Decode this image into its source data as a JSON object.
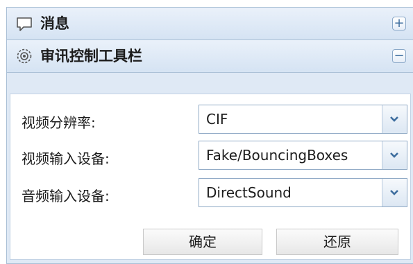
{
  "panel": {
    "sections": [
      {
        "title": "消息",
        "icon": "message-icon",
        "toggle": "+"
      },
      {
        "title": "审讯控制工具栏",
        "icon": "gear-icon",
        "toggle": "−"
      }
    ]
  },
  "form": {
    "fields": [
      {
        "label": "视频分辨率:",
        "value": "CIF"
      },
      {
        "label": "视频输入设备:",
        "value": "Fake/BouncingBoxes"
      },
      {
        "label": "音频输入设备:",
        "value": "DirectSound"
      }
    ],
    "confirm_label": "确定",
    "reset_label": "还原"
  },
  "colors": {
    "header_bg": "#dfe9f5",
    "border": "#a9bfd6",
    "accent": "#3d6d9e"
  }
}
